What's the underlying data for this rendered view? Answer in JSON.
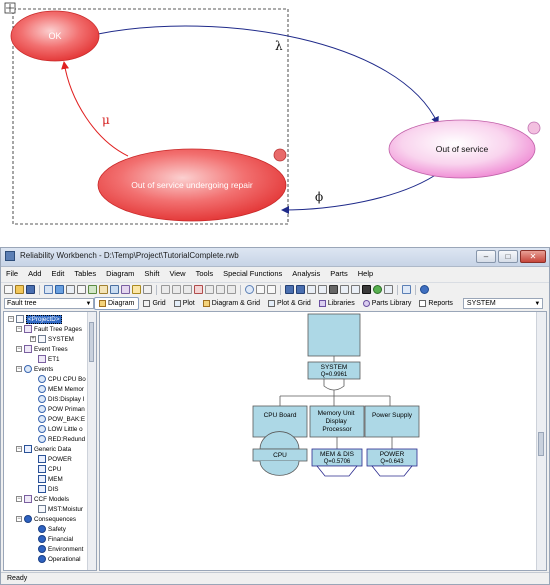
{
  "markov": {
    "states": {
      "ok": "OK",
      "out_of_service": "Out of service",
      "repair": "Out of service undergoing repair"
    },
    "transitions": {
      "lambda": "λ",
      "mu": "μ",
      "phi": "ϕ"
    },
    "colors": {
      "ok_fill": "#ef5a5a",
      "repair_fill": "#ef5a5a",
      "out_fill": "#f6b8e0",
      "arc_blue": "#1f2a8a",
      "arc_red": "#e02020"
    }
  },
  "app": {
    "title": "Reliability Workbench - D:\\Temp\\Project\\TutorialComplete.rwb",
    "menu": [
      "File",
      "Add",
      "Edit",
      "Tables",
      "Diagram",
      "Shift",
      "View",
      "Tools",
      "Special Functions",
      "Analysis",
      "Parts",
      "Help"
    ],
    "tree_selector": "Fault tree",
    "view_tabs": [
      "Diagram",
      "Grid",
      "Plot",
      "Diagram & Grid",
      "Plot & Grid",
      "Libraries",
      "Parts Library",
      "Reports"
    ],
    "system_selector": "SYSTEM",
    "tree": [
      {
        "label": "<ProjectD>",
        "selected": true
      },
      {
        "label": "Fault Tree Pages"
      },
      {
        "label": "SYSTEM"
      },
      {
        "label": "Event Trees"
      },
      {
        "label": "ET1"
      },
      {
        "label": "Events"
      },
      {
        "label": "CPU CPU Bo"
      },
      {
        "label": "MEM Memor"
      },
      {
        "label": "DIS:Display I"
      },
      {
        "label": "POW Priman"
      },
      {
        "label": "POW_BAK:E"
      },
      {
        "label": "LOW Little o"
      },
      {
        "label": "RED:Redund"
      },
      {
        "label": "Generic Data"
      },
      {
        "label": "POWER"
      },
      {
        "label": "CPU"
      },
      {
        "label": "MEM"
      },
      {
        "label": "DIS"
      },
      {
        "label": "CCF Models"
      },
      {
        "label": "MST:Moistur"
      },
      {
        "label": "Consequences"
      },
      {
        "label": "Safety"
      },
      {
        "label": "Financial"
      },
      {
        "label": "Environment"
      },
      {
        "label": "Operational"
      }
    ],
    "fault_tree": {
      "top_name": "SYSTEM",
      "top_q": "Q=0.9961",
      "cpu_board": "CPU Board",
      "memory_unit": "Memory Unit Display Processor",
      "power_supply": "Power Supply",
      "cpu_event": "CPU",
      "mem_dis": "MEM & DIS",
      "mem_dis_q": "Q=0.5706",
      "power": "POWER",
      "power_q": "Q=0.643",
      "colors": {
        "box_fill": "#add8e6",
        "line": "#5a5a5a",
        "transfer_border": "#2b2b8f"
      }
    },
    "status": "Ready"
  }
}
